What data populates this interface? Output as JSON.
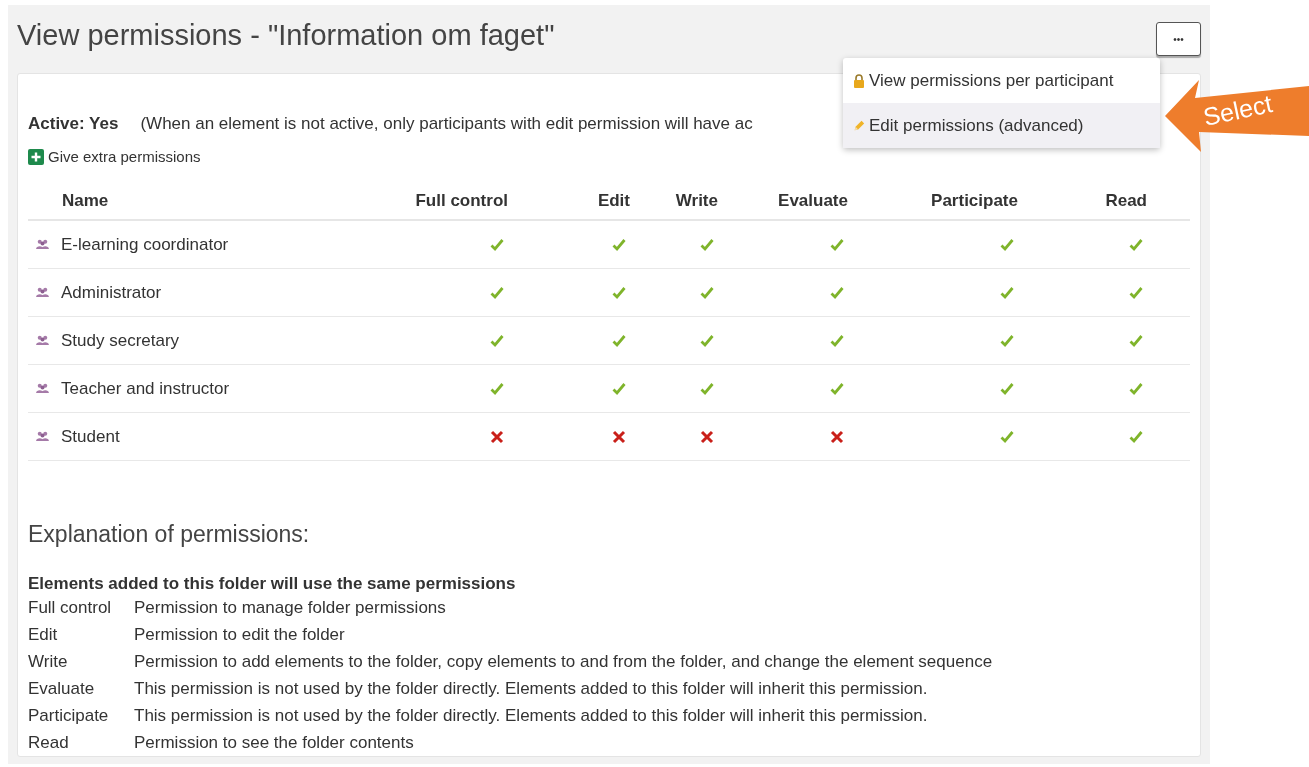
{
  "page": {
    "title": "View permissions - \"Information om faget\"",
    "more_button": "•••"
  },
  "menu": {
    "items": [
      {
        "label": "View permissions per participant",
        "kind": "view",
        "selected": false
      },
      {
        "label": "Edit permissions (advanced)",
        "kind": "edit",
        "selected": true
      }
    ]
  },
  "callout": {
    "label": "Select"
  },
  "status": {
    "label": "Active: Yes",
    "note": "(When an element is not active, only participants with edit permission will have ac"
  },
  "add_link": {
    "label": "Give extra permissions"
  },
  "table": {
    "columns": [
      "Name",
      "Full control",
      "Edit",
      "Write",
      "Evaluate",
      "Participate",
      "Read"
    ],
    "rows": [
      {
        "name": "E-learning coordinator",
        "granted": [
          true,
          true,
          true,
          true,
          true,
          true
        ]
      },
      {
        "name": "Administrator",
        "granted": [
          true,
          true,
          true,
          true,
          true,
          true
        ]
      },
      {
        "name": "Study secretary",
        "granted": [
          true,
          true,
          true,
          true,
          true,
          true
        ]
      },
      {
        "name": "Teacher and instructor",
        "granted": [
          true,
          true,
          true,
          true,
          true,
          true
        ]
      },
      {
        "name": "Student",
        "granted": [
          false,
          false,
          false,
          false,
          true,
          true
        ]
      }
    ]
  },
  "explanation": {
    "heading": "Explanation of permissions:",
    "subheading": "Elements added to this folder will use the same permissions",
    "items": [
      {
        "term": "Full control",
        "text": "Permission to manage folder permissions"
      },
      {
        "term": "Edit",
        "text": "Permission to edit the folder"
      },
      {
        "term": "Write",
        "text": "Permission to add elements to the folder, copy elements to and from the folder, and change the element sequence"
      },
      {
        "term": "Evaluate",
        "text": "This permission is not used by the folder directly. Elements added to this folder will inherit this permission."
      },
      {
        "term": "Participate",
        "text": "This permission is not used by the folder directly. Elements added to this folder will inherit this permission."
      },
      {
        "term": "Read",
        "text": "Permission to see the folder contents"
      }
    ]
  }
}
